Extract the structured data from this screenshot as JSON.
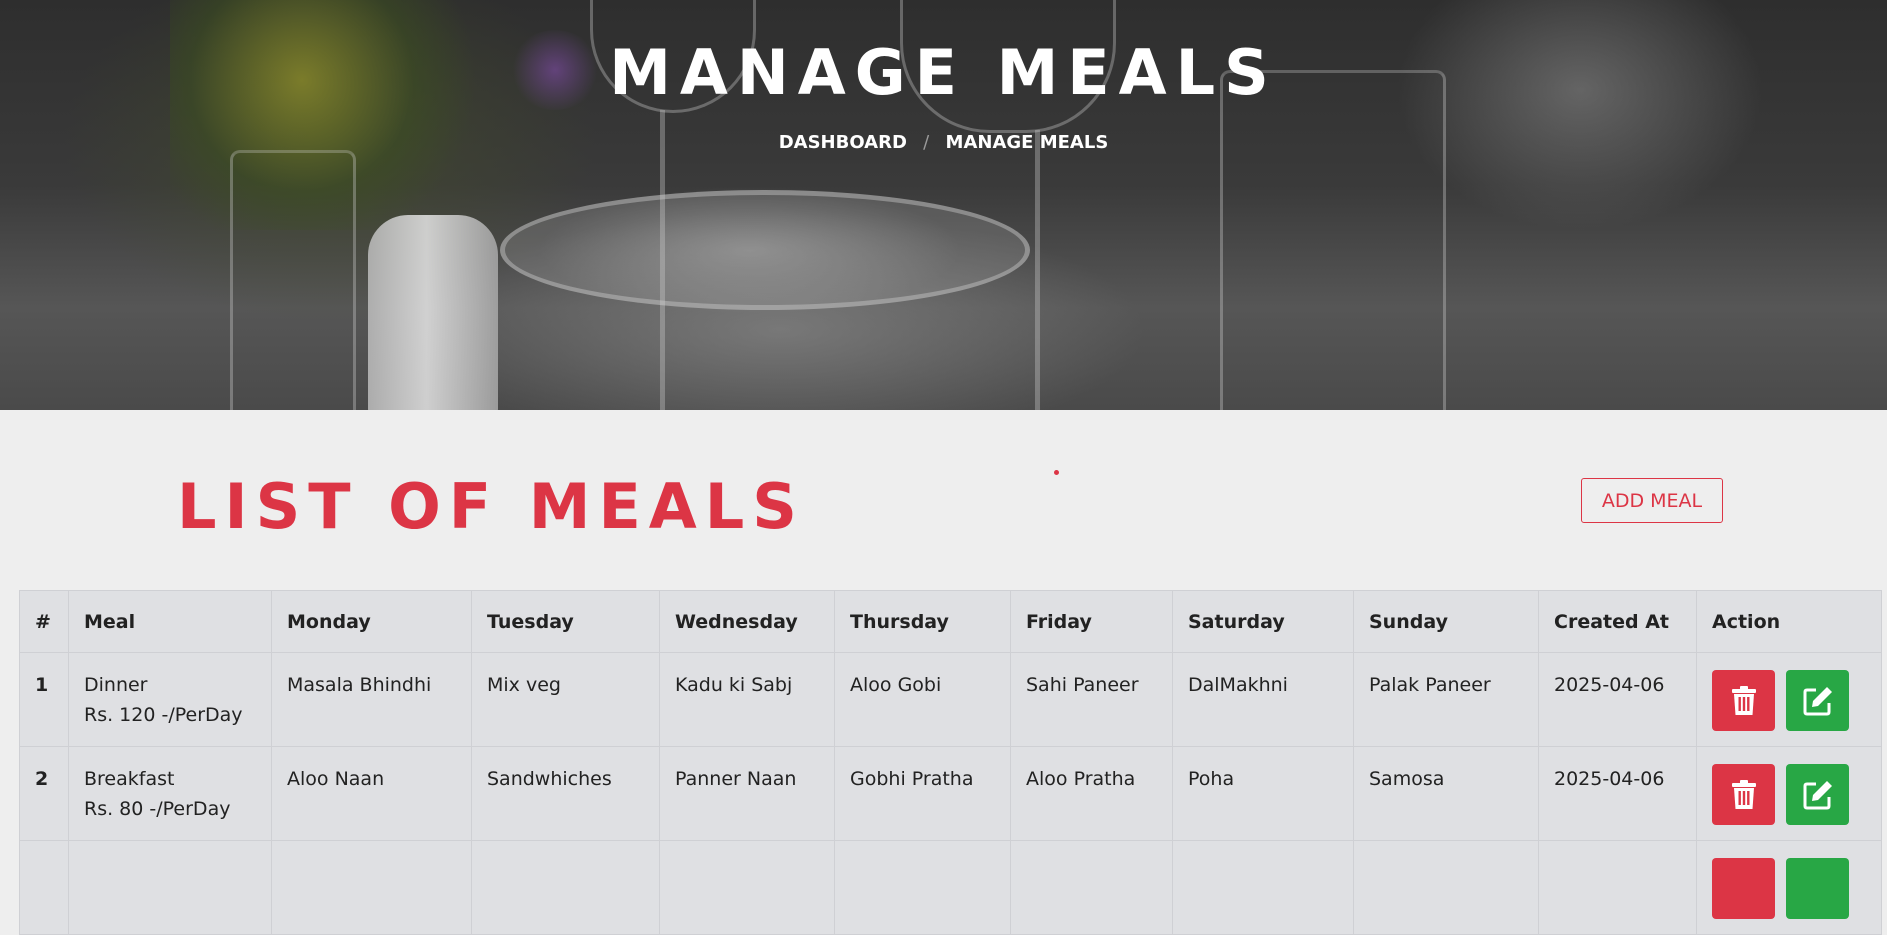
{
  "hero": {
    "title": "MANAGE MEALS",
    "breadcrumb": [
      {
        "label": "DASHBOARD"
      },
      {
        "label": "MANAGE MEALS"
      }
    ],
    "separator": "/"
  },
  "section": {
    "title": "LIST OF MEALS",
    "add_button_label": "ADD MEAL"
  },
  "table": {
    "headers": [
      "#",
      "Meal",
      "Monday",
      "Tuesday",
      "Wednesday",
      "Thursday",
      "Friday",
      "Saturday",
      "Sunday",
      "Created At",
      "Action"
    ],
    "rows": [
      {
        "num": "1",
        "meal_name": "Dinner",
        "meal_price": "Rs. 120 -/PerDay",
        "monday": "Masala Bhindhi",
        "tuesday": "Mix veg",
        "wednesday": "Kadu ki Sabj",
        "thursday": "Aloo Gobi",
        "friday": "Sahi Paneer",
        "saturday": "DalMakhni",
        "sunday": "Palak Paneer",
        "created_at": "2025-04-06"
      },
      {
        "num": "2",
        "meal_name": "Breakfast",
        "meal_price": "Rs. 80 -/PerDay",
        "monday": "Aloo Naan",
        "tuesday": "Sandwhiches",
        "wednesday": "Panner Naan",
        "thursday": "Gobhi Pratha",
        "friday": "Aloo Pratha",
        "saturday": "Poha",
        "sunday": "Samosa",
        "created_at": "2025-04-06"
      }
    ]
  },
  "icons": {
    "delete": "trash-icon",
    "edit": "edit-icon"
  },
  "colors": {
    "accent": "#dc3545",
    "success": "#28a745"
  }
}
